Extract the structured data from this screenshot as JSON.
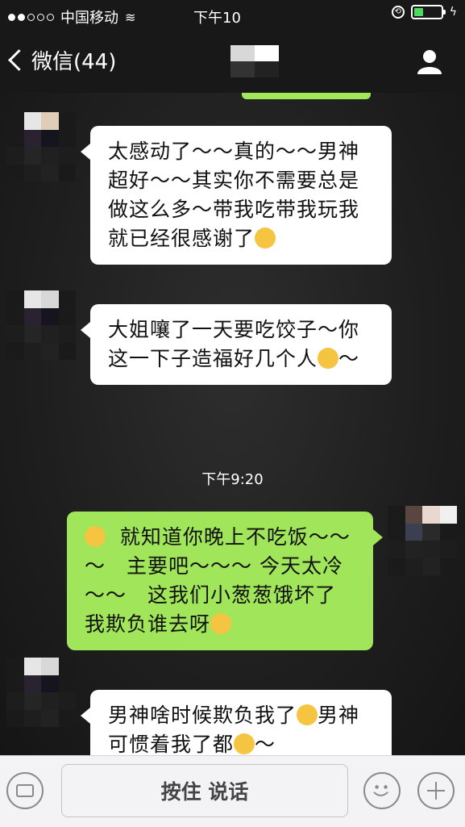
{
  "status_bar": {
    "carrier": "中国移动",
    "time": "下午10"
  },
  "nav": {
    "back_label": "微信(44)"
  },
  "messages": [
    {
      "side": "in",
      "text": "太感动了～～真的～～男神超好～～其实你不需要总是做这么多～带我吃带我玩我就已经很感谢了",
      "emoji_after": "crying-laughing"
    },
    {
      "side": "in",
      "text": "大姐嚷了一天要吃饺子～你这一下子造福好几个人",
      "emoji_after": "heart-eyes",
      "trail": "～"
    },
    {
      "side": "out",
      "text_a": "就知道你晚上不吃饭～～～　主要吧～～～ 今天太冷～～　这我们小葱葱饿坏了　我欺负谁去呀"
    },
    {
      "side": "in",
      "text_a": "男神啥时候欺负我了",
      "text_b": "男神可惯着我了都",
      "trail": "～"
    }
  ],
  "timestamp": "下午9:20",
  "input_bar": {
    "hold_to_talk": "按住 说话"
  },
  "colors": {
    "outgoing_bubble": "#a0e55a",
    "incoming_bubble": "#ffffff",
    "battery": "#4cd964"
  }
}
